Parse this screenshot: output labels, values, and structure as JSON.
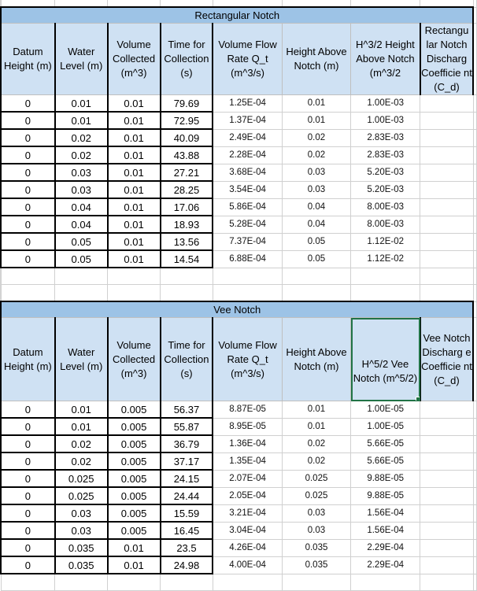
{
  "colors": {
    "title_fill": "#9dc3e6",
    "header_fill": "#cfe1f3",
    "selection_border": "#217346",
    "gridline": "#d0d0d0"
  },
  "rectangular": {
    "title": "Rectangular Notch",
    "headers": [
      "Datum Height (m)",
      "Water Level (m)",
      "Volume Collected (m^3)",
      "Time for Collection (s)",
      "Volume Flow Rate Q_t (m^3/s)",
      "Height Above Notch (m)",
      "H^3/2 Height Above Notch (m^3/2",
      "Rectangular Notch Discharge Coefficient (C_d)"
    ],
    "headers_display": [
      "Datum Height (m)",
      "Water Level (m)",
      "Volume Collected (m^3)",
      "Time for Collection (s)",
      "Volume Flow Rate Q_t (m^3/s)",
      "Height Above Notch (m)",
      "H^3/2 Height Above Notch (m^3/2",
      "Rectangu lar Notch Discharg Coefficie nt (C_d)"
    ],
    "rows": [
      [
        "0",
        "0.01",
        "0.01",
        "79.69",
        "1.25E-04",
        "0.01",
        "1.00E-03",
        ""
      ],
      [
        "0",
        "0.01",
        "0.01",
        "72.95",
        "1.37E-04",
        "0.01",
        "1.00E-03",
        ""
      ],
      [
        "0",
        "0.02",
        "0.01",
        "40.09",
        "2.49E-04",
        "0.02",
        "2.83E-03",
        ""
      ],
      [
        "0",
        "0.02",
        "0.01",
        "43.88",
        "2.28E-04",
        "0.02",
        "2.83E-03",
        ""
      ],
      [
        "0",
        "0.03",
        "0.01",
        "27.21",
        "3.68E-04",
        "0.03",
        "5.20E-03",
        ""
      ],
      [
        "0",
        "0.03",
        "0.01",
        "28.25",
        "3.54E-04",
        "0.03",
        "5.20E-03",
        ""
      ],
      [
        "0",
        "0.04",
        "0.01",
        "17.06",
        "5.86E-04",
        "0.04",
        "8.00E-03",
        ""
      ],
      [
        "0",
        "0.04",
        "0.01",
        "18.93",
        "5.28E-04",
        "0.04",
        "8.00E-03",
        ""
      ],
      [
        "0",
        "0.05",
        "0.01",
        "13.56",
        "7.37E-04",
        "0.05",
        "1.12E-02",
        ""
      ],
      [
        "0",
        "0.05",
        "0.01",
        "14.54",
        "6.88E-04",
        "0.05",
        "1.12E-02",
        ""
      ]
    ]
  },
  "vee": {
    "title": "Vee Notch",
    "headers_display": [
      "Datum Height (m)",
      "Water Level (m)",
      "Volume Collected (m^3)",
      "Time for Collection (s)",
      "Volume Flow Rate Q_t (m^3/s)",
      "Height Above Notch (m)",
      "H^5/2 Vee Notch (m^5/2)",
      "Vee Notch Discharg e Coefficie nt (C_d)"
    ],
    "selected_header_index": 6,
    "rows": [
      [
        "0",
        "0.01",
        "0.005",
        "56.37",
        "8.87E-05",
        "0.01",
        "1.00E-05",
        ""
      ],
      [
        "0",
        "0.01",
        "0.005",
        "55.87",
        "8.95E-05",
        "0.01",
        "1.00E-05",
        ""
      ],
      [
        "0",
        "0.02",
        "0.005",
        "36.79",
        "1.36E-04",
        "0.02",
        "5.66E-05",
        ""
      ],
      [
        "0",
        "0.02",
        "0.005",
        "37.17",
        "1.35E-04",
        "0.02",
        "5.66E-05",
        ""
      ],
      [
        "0",
        "0.025",
        "0.005",
        "24.15",
        "2.07E-04",
        "0.025",
        "9.88E-05",
        ""
      ],
      [
        "0",
        "0.025",
        "0.005",
        "24.44",
        "2.05E-04",
        "0.025",
        "9.88E-05",
        ""
      ],
      [
        "0",
        "0.03",
        "0.005",
        "15.59",
        "3.21E-04",
        "0.03",
        "1.56E-04",
        ""
      ],
      [
        "0",
        "0.03",
        "0.005",
        "16.45",
        "3.04E-04",
        "0.03",
        "1.56E-04",
        ""
      ],
      [
        "0",
        "0.035",
        "0.01",
        "23.5",
        "4.26E-04",
        "0.035",
        "2.29E-04",
        ""
      ],
      [
        "0",
        "0.035",
        "0.01",
        "24.98",
        "4.00E-04",
        "0.035",
        "2.29E-04",
        ""
      ]
    ]
  }
}
